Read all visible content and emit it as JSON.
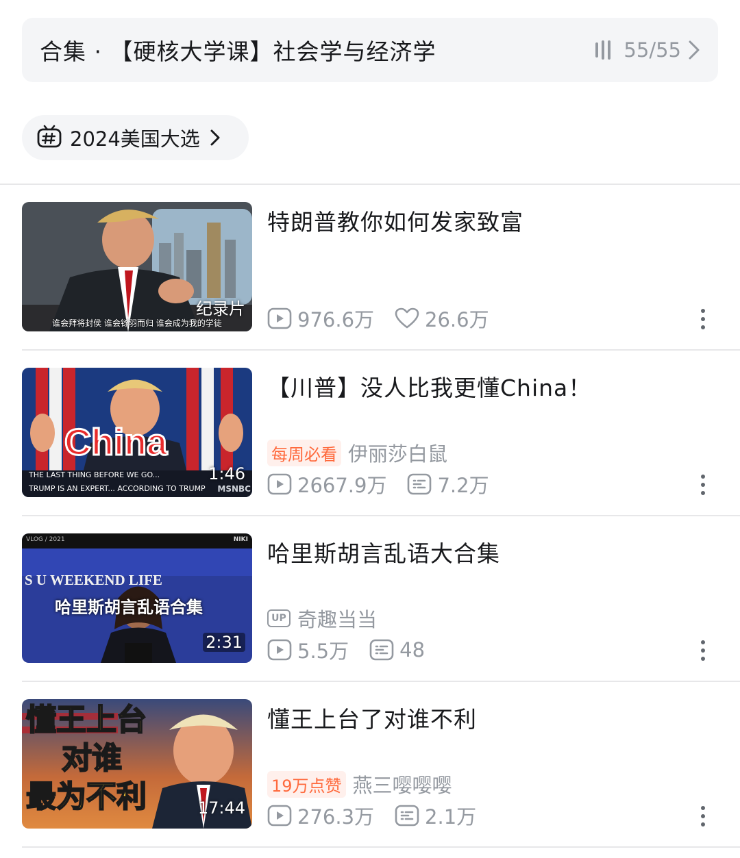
{
  "collection": {
    "title": "合集 · 【硬核大学课】社会学与经济学",
    "progress": "55/55"
  },
  "topic": {
    "label": "2024美国大选"
  },
  "videos": [
    {
      "title": "特朗普教你如何发家致富",
      "badge": "纪录片",
      "thumb_caption": "谁会拜将封侯 谁会铩羽而归 谁会成为我的学徒",
      "views": "976.6万",
      "second_stat": "26.6万",
      "second_icon": "like-icon"
    },
    {
      "title": "【川普】没人比我更懂China！",
      "badge": "1:46",
      "thumb_text_big": "China",
      "thumb_text_small1": "THE LAST THING BEFORE WE GO...",
      "thumb_text_small2": "TRUMP IS AN EXPERT... ACCORDING TO TRUMP",
      "thumb_logo": "MSNBC",
      "tag": "每周必看",
      "author": "伊丽莎白鼠",
      "views": "2667.9万",
      "second_stat": "7.2万",
      "second_icon": "danmaku-icon"
    },
    {
      "title": "哈里斯胡言乱语大合集",
      "badge": "2:31",
      "thumb_text_top": "S U WEEKEND LIFE",
      "thumb_text_main": "哈里斯胡言乱语合集",
      "thumb_text_corner_left": "VLOG / 2021",
      "thumb_text_corner_right": "NIKI",
      "up_label": "UP",
      "author": "奇趣当当",
      "views": "5.5万",
      "second_stat": "48",
      "second_icon": "danmaku-icon"
    },
    {
      "title": "懂王上台了对谁不利",
      "badge": "17:44",
      "thumb_lines": [
        "懂王上台",
        "对谁",
        "最为不利"
      ],
      "tag": "19万点赞",
      "author": "燕三嘤嘤嘤",
      "views": "276.3万",
      "second_stat": "2.1万",
      "second_icon": "danmaku-icon"
    }
  ]
}
